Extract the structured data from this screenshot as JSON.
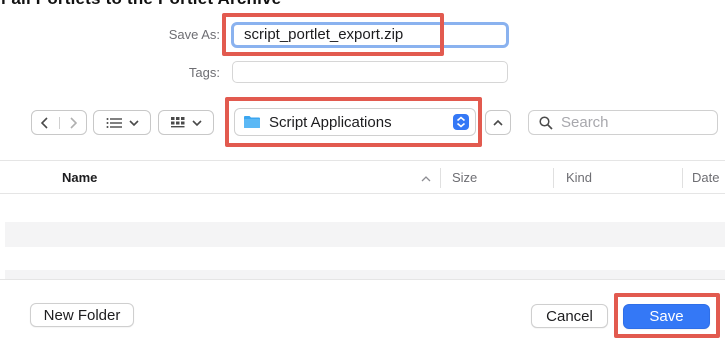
{
  "top_partial_text": "of all Portlets to the Portlet Archive",
  "save_as": {
    "label": "Save As:",
    "value": "script_portlet_export.zip"
  },
  "tags": {
    "label": "Tags:",
    "value": ""
  },
  "toolbar": {
    "back_icon": "chevron-left-icon",
    "forward_icon": "chevron-right-icon",
    "list_view_icon": "list-view-icon",
    "grid_view_icon": "grid-view-icon",
    "location": "Script Applications",
    "expand_icon": "chevron-up-icon",
    "search_placeholder": "Search"
  },
  "columns": [
    "Name",
    "Size",
    "Kind",
    "Date"
  ],
  "buttons": {
    "new_folder": "New Folder",
    "cancel": "Cancel",
    "save": "Save"
  },
  "colors": {
    "accent": "#3478f6",
    "highlight": "#e25a4f"
  }
}
